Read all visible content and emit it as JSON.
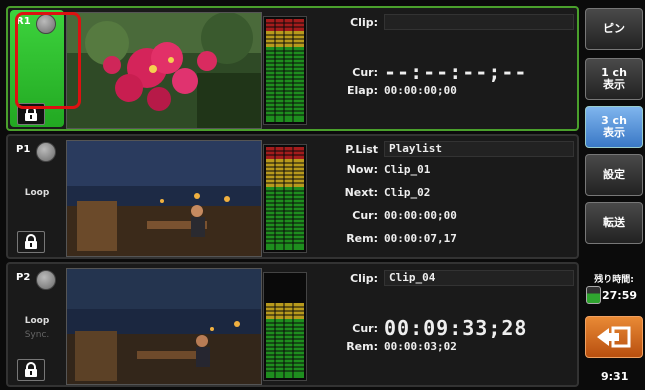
{
  "channels": {
    "r1": {
      "label": "R1",
      "clip_key": "Clip:",
      "clip_value": "",
      "cur_key": "Cur:",
      "cur_value": "--:--:--;--",
      "elap_key": "Elap:",
      "elap_value": "00:00:00;00"
    },
    "p1": {
      "label": "P1",
      "mode": "Loop",
      "plist_key": "P.List",
      "plist_value": "Playlist",
      "now_key": "Now:",
      "now_value": "Clip_01",
      "next_key": "Next:",
      "next_value": "Clip_02",
      "cur_key": "Cur:",
      "cur_value": "00:00:00;00",
      "rem_key": "Rem:",
      "rem_value": "00:00:07,17"
    },
    "p2": {
      "label": "P2",
      "mode": "Loop",
      "mode2": "Sync.",
      "clip_key": "Clip:",
      "clip_value": "Clip_04",
      "cur_key": "Cur:",
      "cur_value": "00:09:33;28",
      "rem_key": "Rem:",
      "rem_value": "00:00:03;02"
    }
  },
  "right_panel": {
    "pin": "ピン",
    "ch1_line1": "1 ch",
    "ch1_line2": "表示",
    "ch3_line1": "3 ch",
    "ch3_line2": "表示",
    "settings": "設定",
    "transfer": "転送",
    "remaining_label": "残り時間:",
    "remaining_time": "27:59",
    "clock": "9:31",
    "exit_icon": "exit-arrow-icon"
  },
  "colors": {
    "active_border": "#4aa02c",
    "record_green": "#2dbd2d",
    "selected_blue": "#5b95dc",
    "exit_orange": "#d06a20",
    "highlight_red": "#dd1111"
  }
}
